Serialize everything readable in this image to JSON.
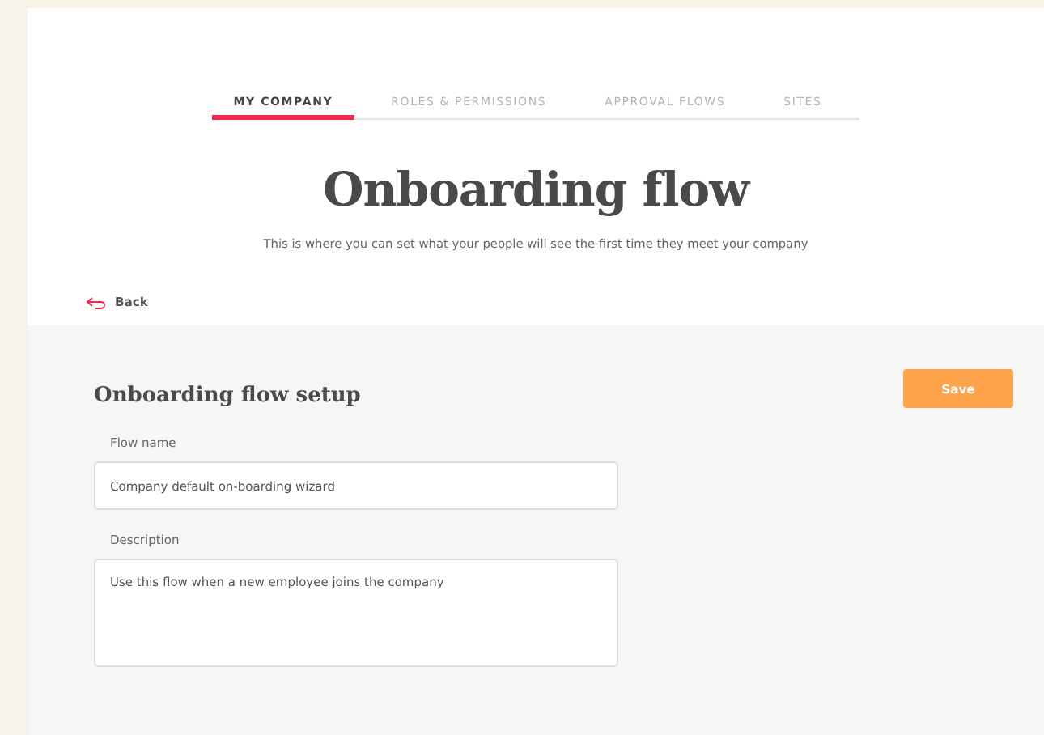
{
  "tabs": [
    {
      "label": "MY COMPANY",
      "selected": true
    },
    {
      "label": "ROLES & PERMISSIONS",
      "selected": false
    },
    {
      "label": "APPROVAL FLOWS",
      "selected": false
    },
    {
      "label": "SITES",
      "selected": false
    }
  ],
  "title": "Onboarding flow",
  "subtitle": "This is where you can set what your people will see the first time they meet your company",
  "back": "Back",
  "setup": {
    "heading": "Onboarding flow setup",
    "save": "Save",
    "flow_name": {
      "label": "Flow name",
      "value": "Company default on-boarding wizard"
    },
    "description": {
      "label": "Description",
      "value": "Use this flow when a new employee joins the company"
    }
  }
}
